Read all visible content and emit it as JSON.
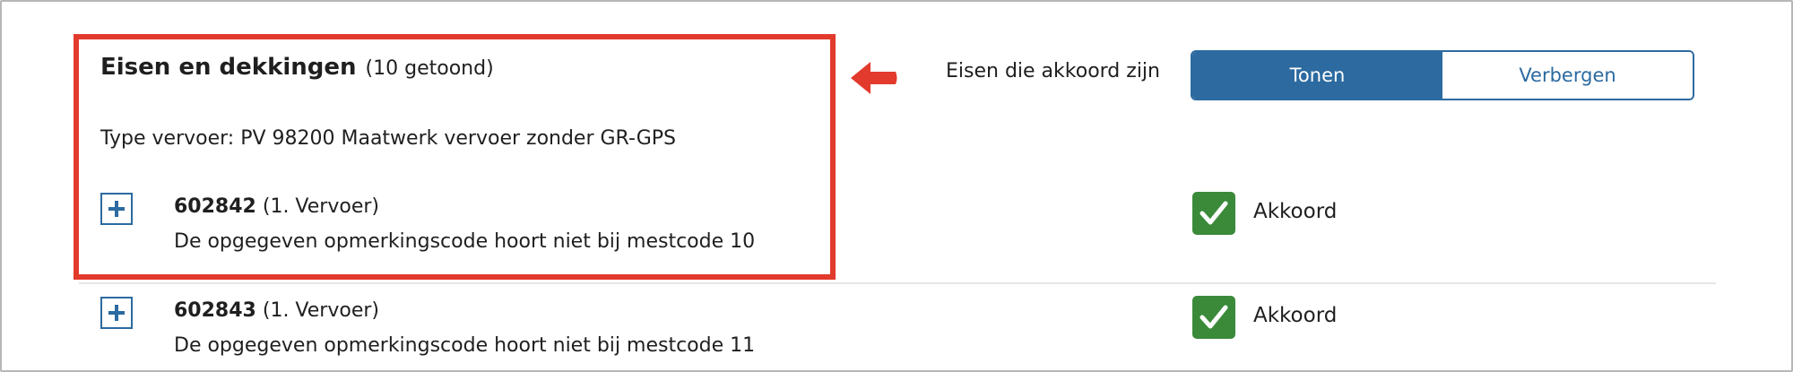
{
  "section": {
    "title": "Eisen en dekkingen",
    "count": "(10 getoond)",
    "transport_type": "Type vervoer: PV 98200 Maatwerk vervoer zonder GR-GPS"
  },
  "filter": {
    "label": "Eisen die akkoord zijn",
    "options": [
      "Tonen",
      "Verbergen"
    ],
    "selected": "Tonen"
  },
  "requirements": [
    {
      "code": "602842",
      "category": "(1. Vervoer)",
      "description": "De opgegeven opmerkingscode hoort niet bij mestcode 10",
      "status": "Akkoord"
    },
    {
      "code": "602843",
      "category": "(1. Vervoer)",
      "description": "De opgegeven opmerkingscode hoort niet bij mestcode 11",
      "status": "Akkoord"
    }
  ],
  "colors": {
    "accent": "#2c6aa0",
    "highlight": "#e23a2c",
    "success": "#3a8a3a"
  },
  "icons": {
    "annotation_arrow": "arrow-left-icon",
    "expand": "plus-icon",
    "status": "checkmark-icon"
  }
}
